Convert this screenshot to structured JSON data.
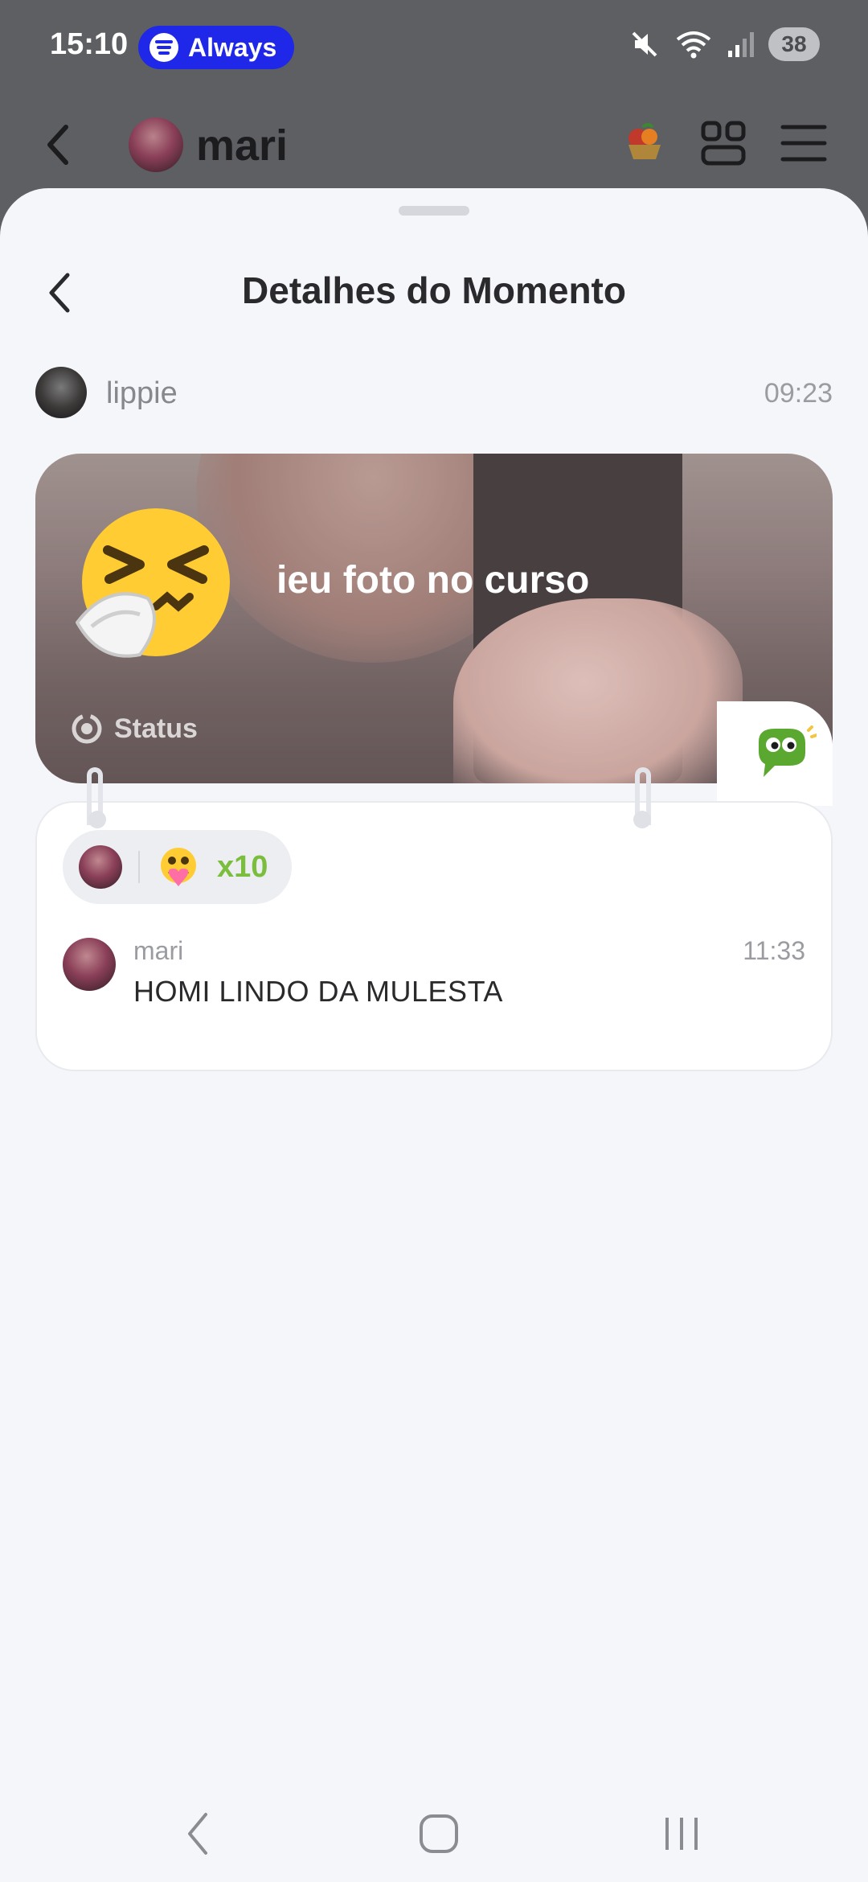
{
  "status_bar": {
    "time": "15:10",
    "media_pill_label": "Always",
    "media_app_icon": "spotify-icon",
    "icons": [
      "mute-icon",
      "wifi-icon",
      "signal-icon"
    ],
    "battery": "38"
  },
  "chat_header": {
    "name": "mari",
    "icons": [
      "fruit-basket-icon",
      "grid-icon",
      "menu-icon"
    ]
  },
  "sheet": {
    "title": "Detalhes do Momento",
    "author": {
      "name": "lippie",
      "time": "09:23"
    },
    "moment": {
      "emoji": "sneezing-face-emoji",
      "caption": "ieu foto no curso",
      "tag": "Status"
    },
    "reactions": {
      "emoji": "hugging-heart-emoji",
      "count": "x10"
    },
    "comments": [
      {
        "name": "mari",
        "time": "11:33",
        "text": "HOMI LINDO DA MULESTA"
      }
    ]
  },
  "colors": {
    "sheet_bg": "#f5f6fa",
    "overlay": "#5d5f62",
    "media_pill": "#1f27e8",
    "reaction_count": "#7bbd3c",
    "bubble_green": "#5aa82f"
  }
}
